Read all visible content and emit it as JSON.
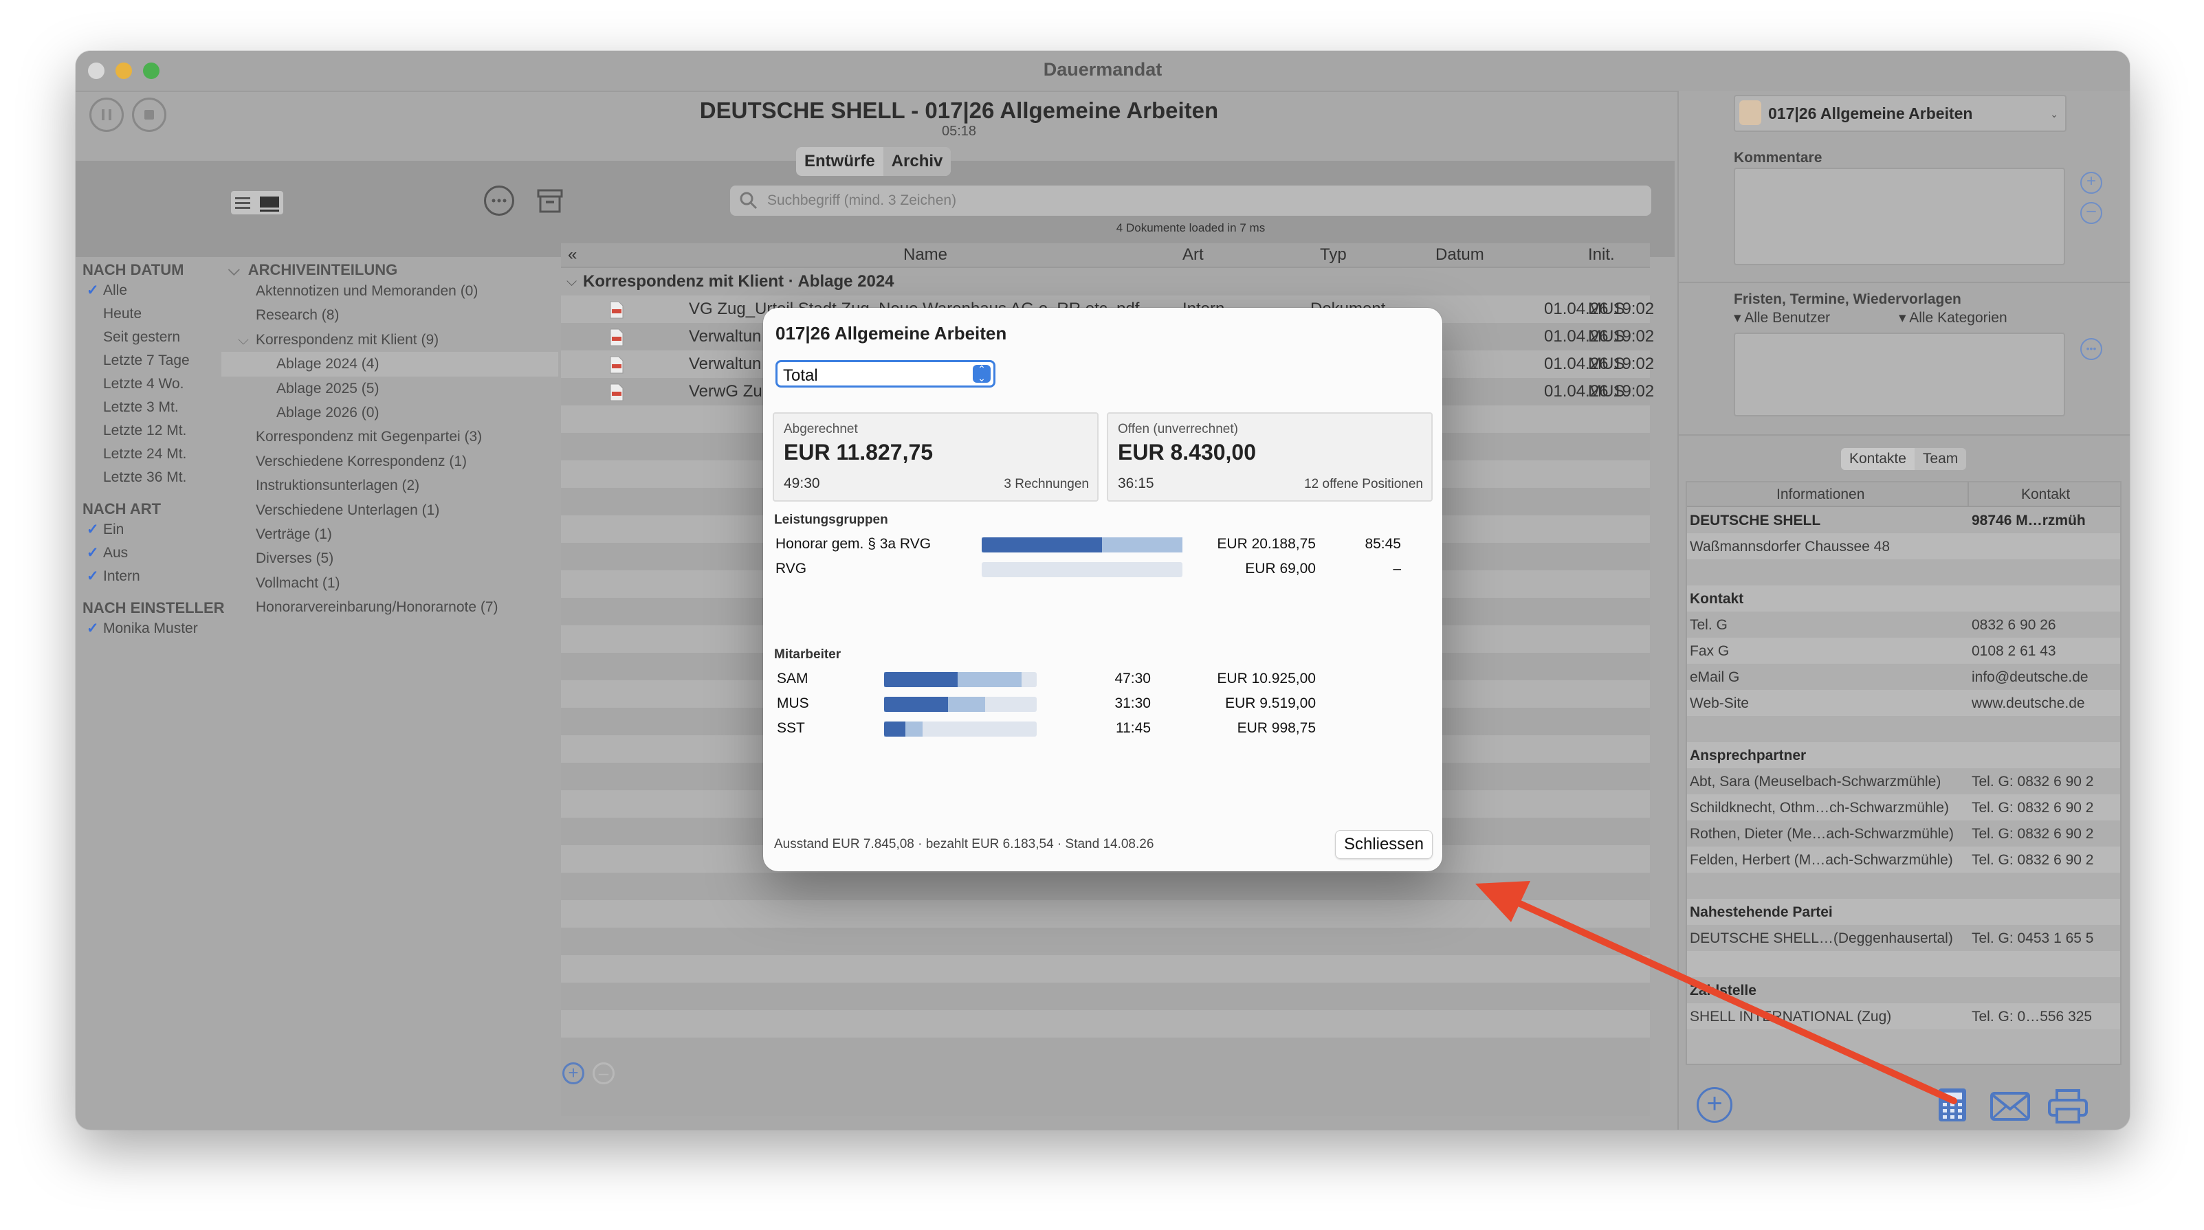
{
  "window": {
    "title": "Dauermandat"
  },
  "header": {
    "title": "DEUTSCHE SHELL - 017|26 Allgemeine Arbeiten",
    "time": "05:18",
    "tabs": [
      "Entwürfe",
      "Archiv"
    ]
  },
  "search": {
    "placeholder": "Suchbegriff (mind. 3 Zeichen)",
    "status": "4 Dokumente loaded in 7 ms"
  },
  "sidebar": {
    "nach_datum": {
      "title": "NACH DATUM",
      "items": [
        "Alle",
        "Heute",
        "Seit gestern",
        "Letzte 7 Tage",
        "Letzte 4 Wo.",
        "Letzte 3 Mt.",
        "Letzte 12 Mt.",
        "Letzte 24 Mt.",
        "Letzte 36 Mt."
      ]
    },
    "nach_art": {
      "title": "NACH ART",
      "items": [
        "Ein",
        "Aus",
        "Intern"
      ]
    },
    "nach_einsteller": {
      "title": "NACH EINSTELLER",
      "items": [
        "Monika Muster"
      ]
    }
  },
  "archive": {
    "title": "ARCHIVEINTEILUNG",
    "items": [
      "Aktennotizen und Memoranden (0)",
      "Research (8)",
      "Korrespondenz mit Klient (9)",
      "Ablage 2024 (4)",
      "Ablage 2025 (5)",
      "Ablage 2026 (0)",
      "Korrespondenz mit Gegenpartei (3)",
      "Verschiedene Korrespondenz (1)",
      "Instruktionsunterlagen (2)",
      "Verschiedene Unterlagen (1)",
      "Verträge (1)",
      "Diverses (5)",
      "Vollmacht (1)",
      "Honorarvereinbarung/Honorarnote (7)"
    ]
  },
  "list": {
    "collapse": "«",
    "columns": [
      "Name",
      "Art",
      "Typ",
      "Datum",
      "Init."
    ],
    "group": "Korrespondenz mit Klient · Ablage 2024",
    "rows": [
      {
        "name": "VG Zug_Urteil Stadt Zug_Neue Warenhaus AG o_RR etc..pdf",
        "art": "Intern",
        "typ": "Dokument",
        "datum": "01.04.26 19:02",
        "init": "MUS"
      },
      {
        "name": "Verwaltun",
        "art": "",
        "typ": "",
        "datum": "01.04.26 19:02",
        "init": "MUS"
      },
      {
        "name": "Verwaltun",
        "art": "",
        "typ": "",
        "datum": "01.04.26 19:02",
        "init": "MUS"
      },
      {
        "name": "VerwG Zu",
        "art": "",
        "typ": "",
        "datum": "01.04.26 19:02",
        "init": "MUS"
      }
    ]
  },
  "right": {
    "matter": "017|26 Allgemeine Arbeiten",
    "kommentare": "Kommentare",
    "fristen": "Fristen, Termine, Wiedervorlagen",
    "filter_users": "Alle Benutzer",
    "filter_cats": "Alle Kategorien",
    "tabs": [
      "Kontakte",
      "Team"
    ],
    "table_cols": [
      "Informationen",
      "Kontakt"
    ],
    "rows": [
      {
        "a": "DEUTSCHE SHELL",
        "b": "98746 M…rzmüh",
        "bold": true
      },
      {
        "a": "Waßmannsdorfer Chaussee 48",
        "b": ""
      },
      {
        "a": "",
        "b": ""
      },
      {
        "a": "Kontakt",
        "b": "",
        "bold": true
      },
      {
        "a": "Tel. G",
        "b": "0832 6 90 26"
      },
      {
        "a": "Fax G",
        "b": "0108 2 61 43"
      },
      {
        "a": "eMail G",
        "b": "info@deutsche.de"
      },
      {
        "a": "Web-Site",
        "b": "www.deutsche.de"
      },
      {
        "a": "",
        "b": ""
      },
      {
        "a": "Ansprechpartner",
        "b": "",
        "bold": true
      },
      {
        "a": "Abt, Sara (Meuselbach-Schwarzmühle)",
        "b": "Tel. G: 0832 6 90 2"
      },
      {
        "a": "Schildknecht, Othm…ch-Schwarzmühle)",
        "b": "Tel. G: 0832 6 90 2"
      },
      {
        "a": "Rothen, Dieter (Me…ach-Schwarzmühle)",
        "b": "Tel. G: 0832 6 90 2"
      },
      {
        "a": "Felden, Herbert (M…ach-Schwarzmühle)",
        "b": "Tel. G: 0832 6 90 2"
      },
      {
        "a": "",
        "b": ""
      },
      {
        "a": "Nahestehende Partei",
        "b": "",
        "bold": true
      },
      {
        "a": "DEUTSCHE SHELL…(Deggenhausertal)",
        "b": "Tel. G: 0453 1 65 5"
      },
      {
        "a": "",
        "b": ""
      },
      {
        "a": "Zahlstelle",
        "b": "",
        "bold": true
      },
      {
        "a": "SHELL INTERNATIONAL (Zug)",
        "b": "Tel. G: 0…556 325"
      }
    ]
  },
  "modal": {
    "title": "017|26 Allgemeine Arbeiten",
    "select_value": "Total",
    "abgerechnet": {
      "label": "Abgerechnet",
      "amount": "EUR 11.827,75",
      "hours": "49:30",
      "count": "3 Rechnungen"
    },
    "offen": {
      "label": "Offen (unverrechnet)",
      "amount": "EUR 8.430,00",
      "hours": "36:15",
      "count": "12 offene Positionen"
    },
    "leistungsgruppen": {
      "title": "Leistungsgruppen",
      "rows": [
        {
          "name": "Honorar gem. § 3a RVG",
          "amount": "EUR 20.188,75",
          "hours": "85:45",
          "billed": 0.6,
          "total": 1.0
        },
        {
          "name": "RVG",
          "amount": "EUR 69,00",
          "hours": "–",
          "billed": 0.0,
          "total": 0.0
        }
      ]
    },
    "mitarbeiter": {
      "title": "Mitarbeiter",
      "rows": [
        {
          "name": "SAM",
          "hours": "47:30",
          "amount": "EUR 10.925,00",
          "billed": 0.48,
          "total": 0.9
        },
        {
          "name": "MUS",
          "hours": "31:30",
          "amount": "EUR 9.519,00",
          "billed": 0.42,
          "total": 0.66
        },
        {
          "name": "SST",
          "hours": "11:45",
          "amount": "EUR 998,75",
          "billed": 0.14,
          "total": 0.25
        }
      ]
    },
    "footer": "Ausstand EUR 7.845,08 · bezahlt EUR 6.183,54 · Stand 14.08.26",
    "close_label": "Schliessen"
  },
  "colors": {
    "accent": "#3c66ad",
    "accent_light": "#a9c1df",
    "arrow": "#e8472b",
    "check": "#3a6fd8"
  }
}
